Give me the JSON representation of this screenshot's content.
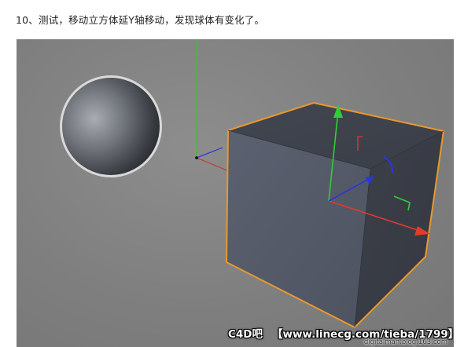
{
  "caption": "10、测试，移动立方体延Y轴移动，发现球体有变化了。",
  "viewport": {
    "background": "#7f7f7f",
    "scene": {
      "sphere": {
        "label": "sphere"
      },
      "cube": {
        "label": "cube",
        "selection_color": "#e8982f"
      },
      "axis_colors": {
        "x": "#e23a2e",
        "y": "#2fcf3a",
        "z": "#2b35d8"
      }
    }
  },
  "watermark": {
    "left": "C4D吧",
    "right": "【www.linecg.com/tieba/1799】"
  },
  "blog_watermark": "digitalman.blog.163.com"
}
